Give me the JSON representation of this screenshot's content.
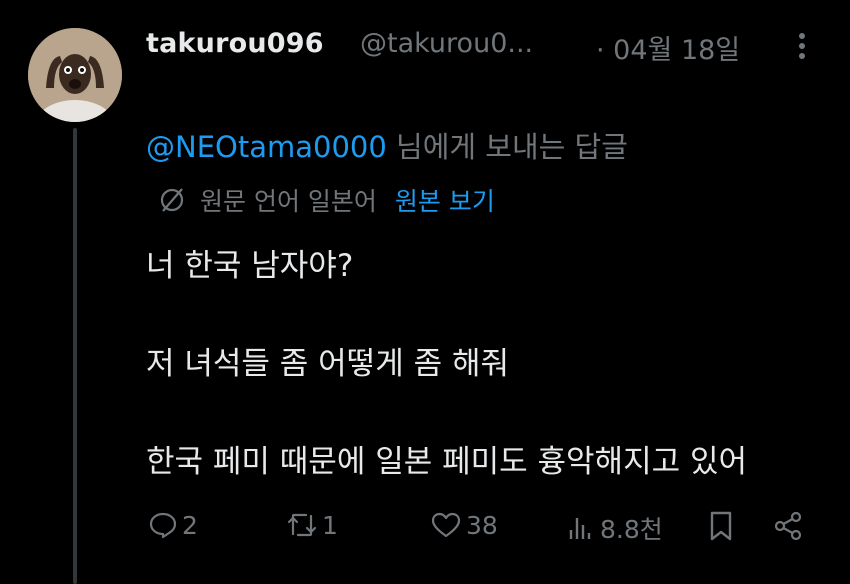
{
  "tweet": {
    "username": "takurou096",
    "handle": "@takurou0...",
    "date": "· 04월 18일",
    "reply_prefix_mention": "@NEOtama0000",
    "reply_suffix": " 님에게 보내는 답글",
    "translation": {
      "note": "원문 언어 일본어",
      "show_original": "원본 보기"
    },
    "body_lines": [
      "너 한국 남자야?",
      "저 녀석들 좀 어떻게 좀 해줘",
      "한국 페미 때문에 일본 페미도 흉악해지고 있어"
    ],
    "actions": {
      "replies": "2",
      "retweets": "1",
      "likes": "38",
      "views": "8.8천"
    }
  },
  "icons": [
    "avatar",
    "more-icon",
    "globe-icon",
    "reply-icon",
    "retweet-icon",
    "like-icon",
    "views-icon",
    "bookmark-icon",
    "share-icon"
  ],
  "colors": {
    "background": "#000000",
    "text": "#e7e9ea",
    "muted": "#71767b",
    "link": "#1d9bf0",
    "thread_line": "#333639"
  }
}
